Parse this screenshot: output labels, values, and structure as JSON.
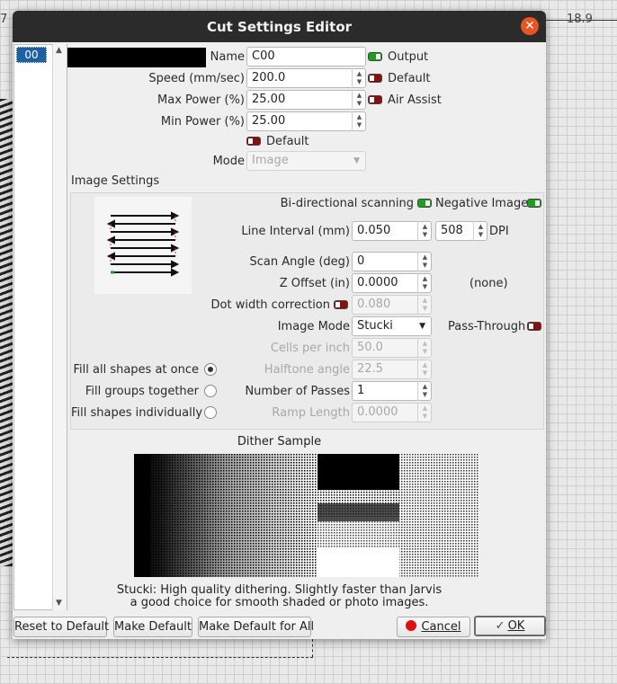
{
  "background": {
    "ruler_left": "7",
    "ruler_right": "18.9"
  },
  "dialog": {
    "title": "Cut Settings Editor",
    "close_icon": "close-icon",
    "accent_color": "#e95420"
  },
  "layer_list": {
    "items": [
      "00"
    ],
    "selected": "00"
  },
  "layer": {
    "color_swatch": "#000000",
    "name_label": "Name",
    "name_value": "C00",
    "speed_label": "Speed (mm/sec)",
    "speed_value": "200.0",
    "max_power_label": "Max Power (%)",
    "max_power_value": "25.00",
    "min_power_label": "Min Power (%)",
    "min_power_value": "25.00",
    "output_label": "Output",
    "output_on": true,
    "default_label": "Default",
    "default_on": false,
    "air_assist_label": "Air Assist",
    "air_assist_on": false,
    "power_default_label": "Default",
    "power_default_on": false,
    "mode_label": "Mode",
    "mode_value": "Image"
  },
  "image_settings": {
    "section_label": "Image Settings",
    "bidirectional_label": "Bi-directional scanning",
    "bidirectional_on": true,
    "negative_label": "Negative Image",
    "negative_on": true,
    "line_interval_label": "Line Interval (mm)",
    "line_interval_value": "0.050",
    "dpi_value": "508",
    "dpi_label": "DPI",
    "scan_angle_label": "Scan Angle (deg)",
    "scan_angle_value": "0",
    "z_offset_label": "Z Offset (in)",
    "z_offset_value": "0.0000",
    "z_offset_note": "(none)",
    "dot_width_label": "Dot width correction",
    "dot_width_on": false,
    "dot_width_value": "0.080",
    "image_mode_label": "Image Mode",
    "image_mode_value": "Stucki",
    "pass_through_label": "Pass-Through",
    "pass_through_on": false,
    "cells_label": "Cells per inch",
    "cells_value": "50.0",
    "halftone_label": "Halftone angle",
    "halftone_value": "22.5",
    "passes_label": "Number of Passes",
    "passes_value": "1",
    "ramp_label": "Ramp Length",
    "ramp_value": "0.0000",
    "fill_options": [
      {
        "label": "Fill all shapes at once",
        "selected": true
      },
      {
        "label": "Fill groups together",
        "selected": false
      },
      {
        "label": "Fill shapes individually",
        "selected": false
      }
    ]
  },
  "dither": {
    "title": "Dither Sample",
    "description_line1": "Stucki: High quality dithering. Slightly faster than Jarvis",
    "description_line2": "a good choice for smooth shaded or photo images."
  },
  "buttons": {
    "reset_default": "Reset to Default",
    "make_default": "Make Default",
    "make_default_all": "Make Default for All",
    "cancel": "Cancel",
    "ok": "OK"
  }
}
